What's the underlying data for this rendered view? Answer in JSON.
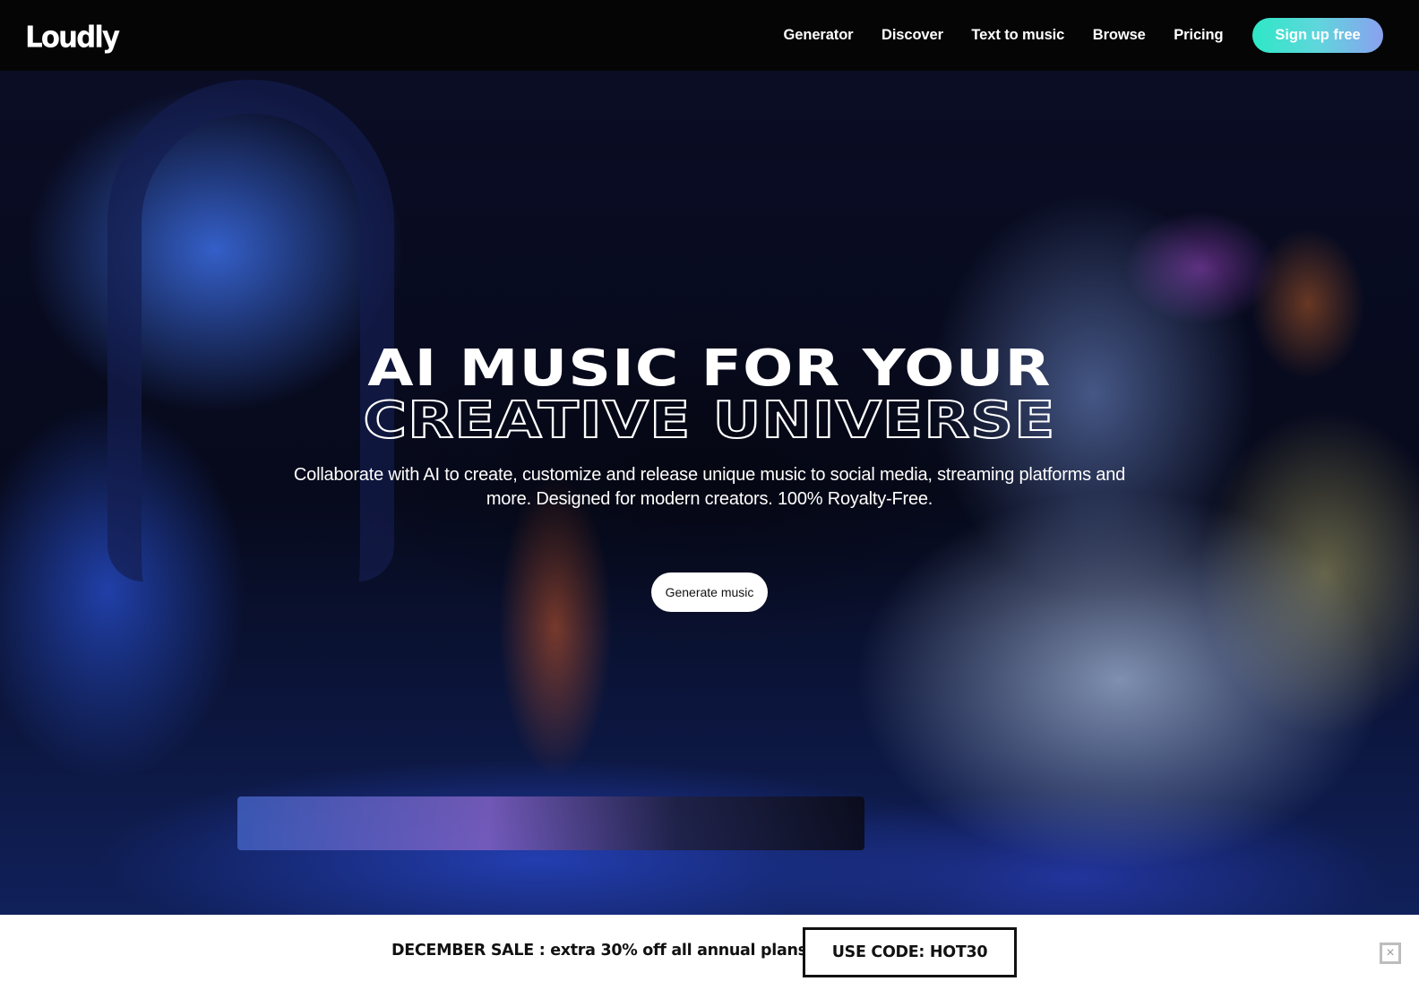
{
  "header": {
    "logo": "Loudly",
    "nav": [
      {
        "label": "Generator"
      },
      {
        "label": "Discover"
      },
      {
        "label": "Text to music"
      },
      {
        "label": "Browse"
      },
      {
        "label": "Pricing"
      }
    ],
    "signup_label": "Sign up free"
  },
  "hero": {
    "headline_line1": "AI MUSIC FOR YOUR",
    "headline_line2": "CREATIVE UNIVERSE",
    "subtitle": "Collaborate with AI to create, customize and release unique music to social media, streaming platforms and more. Designed for modern creators. 100% Royalty-Free.",
    "cta_label": "Generate music"
  },
  "promo": {
    "text": "DECEMBER SALE : extra 30% off all annual plans",
    "code_label": "USE CODE: HOT30",
    "close_icon": "×"
  },
  "colors": {
    "header_bg": "#050505",
    "signup_gradient_start": "#2ee8c6",
    "signup_gradient_end": "#8aa0f0",
    "promo_bg": "#ffffff"
  }
}
